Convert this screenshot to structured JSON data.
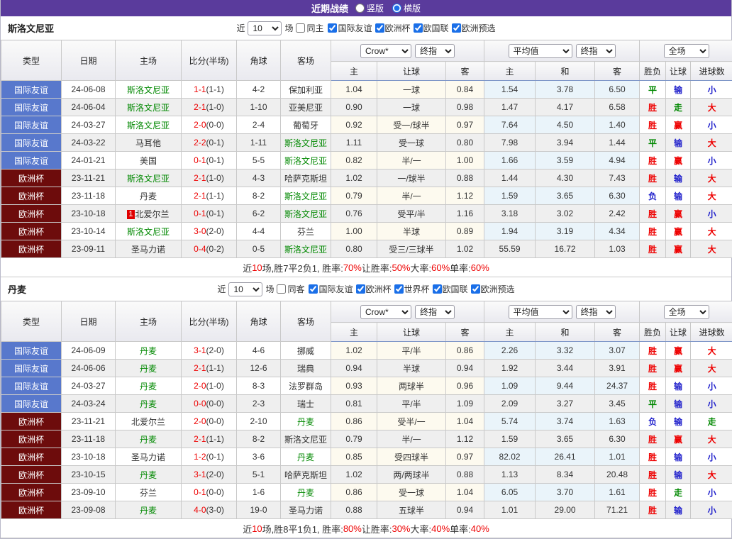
{
  "header": {
    "title": "近期战绩",
    "layout_vertical": "竖版",
    "layout_horizontal": "横版"
  },
  "columns": {
    "type": "类型",
    "date": "日期",
    "home": "主场",
    "score": "比分(半场)",
    "corners": "角球",
    "away": "客场",
    "home_odds": "主",
    "handicap": "让球",
    "away_odds": "客",
    "avg_home": "主",
    "avg_draw": "和",
    "avg_away": "客",
    "result": "胜负",
    "handicap_result": "让球",
    "goals": "进球数"
  },
  "colors": {
    "topbar": "#5a3b9c",
    "friendly_badge": "#5878cc",
    "eurocup_badge": "#6d0c0c",
    "team_green": "#008800",
    "win_red": "#ee0000",
    "lose_blue": "#2121cc",
    "odds_bg": "#fdfaef",
    "avg_bg": "#eaf4fa"
  },
  "sections": [
    {
      "team": "斯洛文尼亚",
      "filter": {
        "near": "近",
        "games": "场",
        "same_venue": "同主",
        "leagues": [
          "国际友谊",
          "欧洲杯",
          "欧国联",
          "欧洲预选"
        ]
      },
      "controls": {
        "recent_count": "10",
        "bookmaker": "Crow*",
        "bookmaker_time": "终指",
        "average": "平均值",
        "average_time": "终指",
        "scope": "全场"
      },
      "rows": [
        {
          "league": "国际友谊",
          "league_type": "friendly",
          "date": "24-06-08",
          "home": "斯洛文尼亚",
          "home_color": "green",
          "home_badge": "",
          "score": "1-1",
          "half": "(1-1)",
          "corners": "4-2",
          "away": "保加利亚",
          "away_color": "",
          "odds_home": "1.04",
          "handicap": "一球",
          "odds_away": "0.84",
          "avg_home": "1.54",
          "avg_draw": "3.78",
          "avg_away": "6.50",
          "result": "平",
          "result_color": "green",
          "handicap_result": "输",
          "handicap_result_color": "blue",
          "goals": "小",
          "goals_color": "blue"
        },
        {
          "league": "国际友谊",
          "league_type": "friendly",
          "date": "24-06-04",
          "home": "斯洛文尼亚",
          "home_color": "green",
          "home_badge": "",
          "score": "2-1",
          "half": "(1-0)",
          "corners": "1-10",
          "away": "亚美尼亚",
          "away_color": "",
          "odds_home": "0.90",
          "handicap": "一球",
          "odds_away": "0.98",
          "avg_home": "1.47",
          "avg_draw": "4.17",
          "avg_away": "6.58",
          "result": "胜",
          "result_color": "red",
          "handicap_result": "走",
          "handicap_result_color": "green",
          "goals": "大",
          "goals_color": "red"
        },
        {
          "league": "国际友谊",
          "league_type": "friendly",
          "date": "24-03-27",
          "home": "斯洛文尼亚",
          "home_color": "green",
          "home_badge": "",
          "score": "2-0",
          "half": "(0-0)",
          "corners": "2-4",
          "away": "葡萄牙",
          "away_color": "",
          "odds_home": "0.92",
          "handicap": "受一/球半",
          "odds_away": "0.97",
          "avg_home": "7.64",
          "avg_draw": "4.50",
          "avg_away": "1.40",
          "result": "胜",
          "result_color": "red",
          "handicap_result": "赢",
          "handicap_result_color": "red",
          "goals": "小",
          "goals_color": "blue"
        },
        {
          "league": "国际友谊",
          "league_type": "friendly",
          "date": "24-03-22",
          "home": "马耳他",
          "home_color": "",
          "home_badge": "",
          "score": "2-2",
          "half": "(0-1)",
          "corners": "1-11",
          "away": "斯洛文尼亚",
          "away_color": "green",
          "odds_home": "1.11",
          "handicap": "受一球",
          "odds_away": "0.80",
          "avg_home": "7.98",
          "avg_draw": "3.94",
          "avg_away": "1.44",
          "result": "平",
          "result_color": "green",
          "handicap_result": "输",
          "handicap_result_color": "blue",
          "goals": "大",
          "goals_color": "red"
        },
        {
          "league": "国际友谊",
          "league_type": "friendly",
          "date": "24-01-21",
          "home": "美国",
          "home_color": "",
          "home_badge": "",
          "score": "0-1",
          "half": "(0-1)",
          "corners": "5-5",
          "away": "斯洛文尼亚",
          "away_color": "green",
          "odds_home": "0.82",
          "handicap": "半/一",
          "odds_away": "1.00",
          "avg_home": "1.66",
          "avg_draw": "3.59",
          "avg_away": "4.94",
          "result": "胜",
          "result_color": "red",
          "handicap_result": "赢",
          "handicap_result_color": "red",
          "goals": "小",
          "goals_color": "blue"
        },
        {
          "league": "欧洲杯",
          "league_type": "eurocup",
          "date": "23-11-21",
          "home": "斯洛文尼亚",
          "home_color": "green",
          "home_badge": "",
          "score": "2-1",
          "half": "(1-0)",
          "corners": "4-3",
          "away": "哈萨克斯坦",
          "away_color": "",
          "odds_home": "1.02",
          "handicap": "一/球半",
          "odds_away": "0.88",
          "avg_home": "1.44",
          "avg_draw": "4.30",
          "avg_away": "7.43",
          "result": "胜",
          "result_color": "red",
          "handicap_result": "输",
          "handicap_result_color": "blue",
          "goals": "大",
          "goals_color": "red"
        },
        {
          "league": "欧洲杯",
          "league_type": "eurocup",
          "date": "23-11-18",
          "home": "丹麦",
          "home_color": "",
          "home_badge": "",
          "score": "2-1",
          "half": "(1-1)",
          "corners": "8-2",
          "away": "斯洛文尼亚",
          "away_color": "green",
          "odds_home": "0.79",
          "handicap": "半/一",
          "odds_away": "1.12",
          "avg_home": "1.59",
          "avg_draw": "3.65",
          "avg_away": "6.30",
          "result": "负",
          "result_color": "blue",
          "handicap_result": "输",
          "handicap_result_color": "blue",
          "goals": "大",
          "goals_color": "red"
        },
        {
          "league": "欧洲杯",
          "league_type": "eurocup",
          "date": "23-10-18",
          "home": "北爱尔兰",
          "home_color": "",
          "home_badge": "1",
          "score": "0-1",
          "half": "(0-1)",
          "corners": "6-2",
          "away": "斯洛文尼亚",
          "away_color": "green",
          "odds_home": "0.76",
          "handicap": "受平/半",
          "odds_away": "1.16",
          "avg_home": "3.18",
          "avg_draw": "3.02",
          "avg_away": "2.42",
          "result": "胜",
          "result_color": "red",
          "handicap_result": "赢",
          "handicap_result_color": "red",
          "goals": "小",
          "goals_color": "blue"
        },
        {
          "league": "欧洲杯",
          "league_type": "eurocup",
          "date": "23-10-14",
          "home": "斯洛文尼亚",
          "home_color": "green",
          "home_badge": "",
          "score": "3-0",
          "half": "(2-0)",
          "corners": "4-4",
          "away": "芬兰",
          "away_color": "",
          "odds_home": "1.00",
          "handicap": "半球",
          "odds_away": "0.89",
          "avg_home": "1.94",
          "avg_draw": "3.19",
          "avg_away": "4.34",
          "result": "胜",
          "result_color": "red",
          "handicap_result": "赢",
          "handicap_result_color": "red",
          "goals": "大",
          "goals_color": "red"
        },
        {
          "league": "欧洲杯",
          "league_type": "eurocup",
          "date": "23-09-11",
          "home": "圣马力诺",
          "home_color": "",
          "home_badge": "",
          "score": "0-4",
          "half": "(0-2)",
          "corners": "0-5",
          "away": "斯洛文尼亚",
          "away_color": "green",
          "odds_home": "0.80",
          "handicap": "受三/三球半",
          "odds_away": "1.02",
          "avg_home": "55.59",
          "avg_draw": "16.72",
          "avg_away": "1.03",
          "result": "胜",
          "result_color": "red",
          "handicap_result": "赢",
          "handicap_result_color": "red",
          "goals": "大",
          "goals_color": "red"
        }
      ],
      "summary": [
        {
          "t": "近"
        },
        {
          "t": "10",
          "red": true
        },
        {
          "t": "场,胜7平2负1, 胜率:"
        },
        {
          "t": "70%",
          "red": true
        },
        {
          "t": " 让胜率:"
        },
        {
          "t": "50%",
          "red": true
        },
        {
          "t": " 大率:"
        },
        {
          "t": "60%",
          "red": true
        },
        {
          "t": " 单率:"
        },
        {
          "t": "60%",
          "red": true
        }
      ]
    },
    {
      "team": "丹麦",
      "filter": {
        "near": "近",
        "games": "场",
        "same_venue": "同客",
        "leagues": [
          "国际友谊",
          "欧洲杯",
          "世界杯",
          "欧国联",
          "欧洲预选"
        ]
      },
      "controls": {
        "recent_count": "10",
        "bookmaker": "Crow*",
        "bookmaker_time": "终指",
        "average": "平均值",
        "average_time": "终指",
        "scope": "全场"
      },
      "rows": [
        {
          "league": "国际友谊",
          "league_type": "friendly",
          "date": "24-06-09",
          "home": "丹麦",
          "home_color": "green",
          "home_badge": "",
          "score": "3-1",
          "half": "(2-0)",
          "corners": "4-6",
          "away": "挪威",
          "away_color": "",
          "odds_home": "1.02",
          "handicap": "平/半",
          "odds_away": "0.86",
          "avg_home": "2.26",
          "avg_draw": "3.32",
          "avg_away": "3.07",
          "result": "胜",
          "result_color": "red",
          "handicap_result": "赢",
          "handicap_result_color": "red",
          "goals": "大",
          "goals_color": "red"
        },
        {
          "league": "国际友谊",
          "league_type": "friendly",
          "date": "24-06-06",
          "home": "丹麦",
          "home_color": "green",
          "home_badge": "",
          "score": "2-1",
          "half": "(1-1)",
          "corners": "12-6",
          "away": "瑞典",
          "away_color": "",
          "odds_home": "0.94",
          "handicap": "半球",
          "odds_away": "0.94",
          "avg_home": "1.92",
          "avg_draw": "3.44",
          "avg_away": "3.91",
          "result": "胜",
          "result_color": "red",
          "handicap_result": "赢",
          "handicap_result_color": "red",
          "goals": "大",
          "goals_color": "red"
        },
        {
          "league": "国际友谊",
          "league_type": "friendly",
          "date": "24-03-27",
          "home": "丹麦",
          "home_color": "green",
          "home_badge": "",
          "score": "2-0",
          "half": "(1-0)",
          "corners": "8-3",
          "away": "法罗群岛",
          "away_color": "",
          "odds_home": "0.93",
          "handicap": "两球半",
          "odds_away": "0.96",
          "avg_home": "1.09",
          "avg_draw": "9.44",
          "avg_away": "24.37",
          "result": "胜",
          "result_color": "red",
          "handicap_result": "输",
          "handicap_result_color": "blue",
          "goals": "小",
          "goals_color": "blue"
        },
        {
          "league": "国际友谊",
          "league_type": "friendly",
          "date": "24-03-24",
          "home": "丹麦",
          "home_color": "green",
          "home_badge": "",
          "score": "0-0",
          "half": "(0-0)",
          "corners": "2-3",
          "away": "瑞士",
          "away_color": "",
          "odds_home": "0.81",
          "handicap": "平/半",
          "odds_away": "1.09",
          "avg_home": "2.09",
          "avg_draw": "3.27",
          "avg_away": "3.45",
          "result": "平",
          "result_color": "green",
          "handicap_result": "输",
          "handicap_result_color": "blue",
          "goals": "小",
          "goals_color": "blue"
        },
        {
          "league": "欧洲杯",
          "league_type": "eurocup",
          "date": "23-11-21",
          "home": "北爱尔兰",
          "home_color": "",
          "home_badge": "",
          "score": "2-0",
          "half": "(0-0)",
          "corners": "2-10",
          "away": "丹麦",
          "away_color": "green",
          "odds_home": "0.86",
          "handicap": "受半/一",
          "odds_away": "1.04",
          "avg_home": "5.74",
          "avg_draw": "3.74",
          "avg_away": "1.63",
          "result": "负",
          "result_color": "blue",
          "handicap_result": "输",
          "handicap_result_color": "blue",
          "goals": "走",
          "goals_color": "green"
        },
        {
          "league": "欧洲杯",
          "league_type": "eurocup",
          "date": "23-11-18",
          "home": "丹麦",
          "home_color": "green",
          "home_badge": "",
          "score": "2-1",
          "half": "(1-1)",
          "corners": "8-2",
          "away": "斯洛文尼亚",
          "away_color": "",
          "odds_home": "0.79",
          "handicap": "半/一",
          "odds_away": "1.12",
          "avg_home": "1.59",
          "avg_draw": "3.65",
          "avg_away": "6.30",
          "result": "胜",
          "result_color": "red",
          "handicap_result": "赢",
          "handicap_result_color": "red",
          "goals": "大",
          "goals_color": "red"
        },
        {
          "league": "欧洲杯",
          "league_type": "eurocup",
          "date": "23-10-18",
          "home": "圣马力诺",
          "home_color": "",
          "home_badge": "",
          "score": "1-2",
          "half": "(0-1)",
          "corners": "3-6",
          "away": "丹麦",
          "away_color": "green",
          "odds_home": "0.85",
          "handicap": "受四球半",
          "odds_away": "0.97",
          "avg_home": "82.02",
          "avg_draw": "26.41",
          "avg_away": "1.01",
          "result": "胜",
          "result_color": "red",
          "handicap_result": "输",
          "handicap_result_color": "blue",
          "goals": "小",
          "goals_color": "blue"
        },
        {
          "league": "欧洲杯",
          "league_type": "eurocup",
          "date": "23-10-15",
          "home": "丹麦",
          "home_color": "green",
          "home_badge": "",
          "score": "3-1",
          "half": "(2-0)",
          "corners": "5-1",
          "away": "哈萨克斯坦",
          "away_color": "",
          "odds_home": "1.02",
          "handicap": "两/两球半",
          "odds_away": "0.88",
          "avg_home": "1.13",
          "avg_draw": "8.34",
          "avg_away": "20.48",
          "result": "胜",
          "result_color": "red",
          "handicap_result": "输",
          "handicap_result_color": "blue",
          "goals": "大",
          "goals_color": "red"
        },
        {
          "league": "欧洲杯",
          "league_type": "eurocup",
          "date": "23-09-10",
          "home": "芬兰",
          "home_color": "",
          "home_badge": "",
          "score": "0-1",
          "half": "(0-0)",
          "corners": "1-6",
          "away": "丹麦",
          "away_color": "green",
          "odds_home": "0.86",
          "handicap": "受一球",
          "odds_away": "1.04",
          "avg_home": "6.05",
          "avg_draw": "3.70",
          "avg_away": "1.61",
          "result": "胜",
          "result_color": "red",
          "handicap_result": "走",
          "handicap_result_color": "green",
          "goals": "小",
          "goals_color": "blue"
        },
        {
          "league": "欧洲杯",
          "league_type": "eurocup",
          "date": "23-09-08",
          "home": "丹麦",
          "home_color": "green",
          "home_badge": "",
          "score": "4-0",
          "half": "(3-0)",
          "corners": "19-0",
          "away": "圣马力诺",
          "away_color": "",
          "odds_home": "0.88",
          "handicap": "五球半",
          "odds_away": "0.94",
          "avg_home": "1.01",
          "avg_draw": "29.00",
          "avg_away": "71.21",
          "result": "胜",
          "result_color": "red",
          "handicap_result": "输",
          "handicap_result_color": "blue",
          "goals": "小",
          "goals_color": "blue"
        }
      ],
      "summary": [
        {
          "t": "近"
        },
        {
          "t": "10",
          "red": true
        },
        {
          "t": "场,胜8平1负1, 胜率:"
        },
        {
          "t": "80%",
          "red": true
        },
        {
          "t": " 让胜率:"
        },
        {
          "t": "30%",
          "red": true
        },
        {
          "t": " 大率:"
        },
        {
          "t": "40%",
          "red": true
        },
        {
          "t": " 单率:"
        },
        {
          "t": "40%",
          "red": true
        }
      ]
    }
  ]
}
